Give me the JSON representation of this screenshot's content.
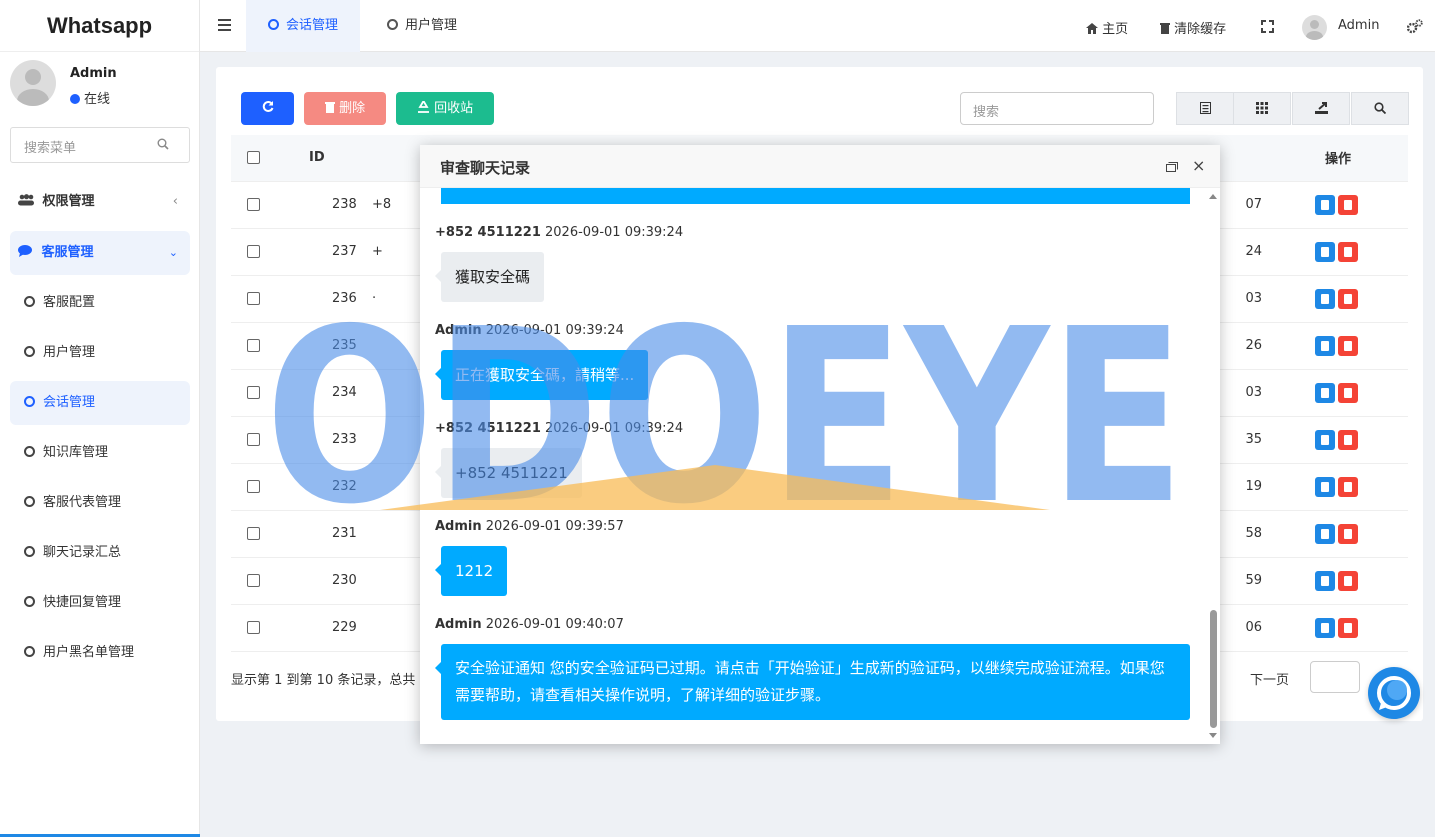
{
  "app": {
    "title": "Whatsapp"
  },
  "user": {
    "name": "Admin",
    "status": "在线"
  },
  "sidebar": {
    "search_placeholder": "搜索菜单",
    "groups": [
      {
        "label": "权限管理"
      },
      {
        "label": "客服管理"
      }
    ],
    "items": [
      {
        "label": "客服配置"
      },
      {
        "label": "用户管理"
      },
      {
        "label": "会话管理"
      },
      {
        "label": "知识库管理"
      },
      {
        "label": "客服代表管理"
      },
      {
        "label": "聊天记录汇总"
      },
      {
        "label": "快捷回复管理"
      },
      {
        "label": "用户黑名单管理"
      }
    ]
  },
  "header": {
    "tabs": [
      {
        "label": "会话管理"
      },
      {
        "label": "用户管理"
      }
    ],
    "home": "主页",
    "clear_cache": "清除缓存",
    "admin": "Admin"
  },
  "toolbar": {
    "delete": "删除",
    "recycle": "回收站",
    "search_placeholder": "搜索"
  },
  "table": {
    "headers": {
      "id": "ID",
      "ops": "操作"
    },
    "rows": [
      {
        "id": "238",
        "c2": "+8",
        "tail": "07"
      },
      {
        "id": "237",
        "c2": "+",
        "tail": "24"
      },
      {
        "id": "236",
        "c2": "·",
        "tail": "03"
      },
      {
        "id": "235",
        "c2": "",
        "tail": "26"
      },
      {
        "id": "234",
        "c2": "",
        "tail": "03"
      },
      {
        "id": "233",
        "c2": "",
        "tail": "35"
      },
      {
        "id": "232",
        "c2": "",
        "tail": "19"
      },
      {
        "id": "231",
        "c2": "",
        "tail": "58"
      },
      {
        "id": "230",
        "c2": "",
        "tail": "59"
      },
      {
        "id": "229",
        "c2": "",
        "tail": "06"
      }
    ]
  },
  "pager": {
    "info": "显示第 1 到第 10 条记录，总共",
    "next": "下一页"
  },
  "modal": {
    "title": "审查聊天记录",
    "messages": [
      {
        "sender": "+852 4511221",
        "time": "2026-09-01 09:39:24",
        "text": "獲取安全碼"
      },
      {
        "sender": "Admin",
        "time": "2026-09-01 09:39:24",
        "text": "正在獲取安全碼，請稍等..."
      },
      {
        "sender": "+852 4511221",
        "time": "2026-09-01 09:39:24",
        "text": "+852 4511221"
      },
      {
        "sender": "Admin",
        "time": "2026-09-01 09:39:57",
        "text": "1212"
      },
      {
        "sender": "Admin",
        "time": "2026-09-01 09:40:07",
        "text": "安全验证通知 您的安全验证码已过期。请点击「开始验证」生成新的验证码，以继续完成验证流程。如果您需要帮助，请查看相关操作说明，了解详细的验证步骤。"
      }
    ]
  },
  "watermark": {
    "text": "ODOEYE"
  },
  "colors": {
    "primary": "#1e60ff",
    "danger": "#f58a82",
    "success": "#1cbc8f",
    "bubble_out": "#00aaff"
  }
}
